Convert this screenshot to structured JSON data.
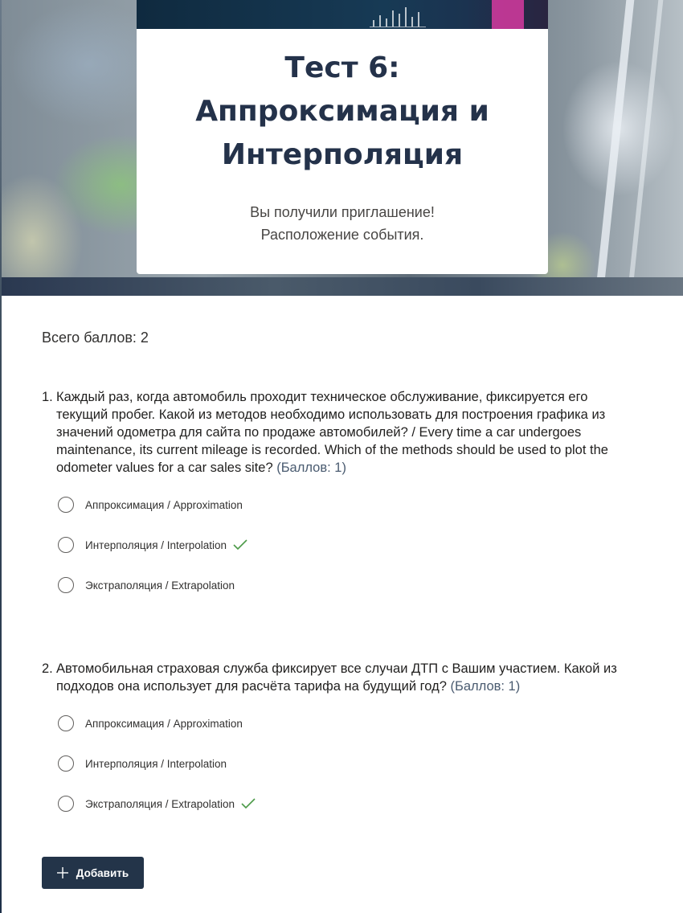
{
  "header": {
    "title_lines": [
      "Тест 6:",
      "Аппроксимация и",
      "Интерполяция"
    ],
    "subtitle_lines": [
      "Вы получили приглашение!",
      "Расположение события."
    ]
  },
  "total_points": "Всего баллов: 2",
  "questions": [
    {
      "number": "1.",
      "text": "Каждый раз, когда автомобиль проходит техническое обслуживание, фиксируется его текущий пробег. Какой из методов необходимо использовать для построения графика из значений одометра для сайта по продаже автомобилей? / Every time a car undergoes maintenance, its current mileage is recorded. Which of the methods should be used to plot the odometer values for a car sales site?",
      "points": "(Баллов: 1)",
      "options": [
        {
          "label": "Аппроксимация / Approximation",
          "correct": false
        },
        {
          "label": "Интерполяция / Interpolation",
          "correct": true
        },
        {
          "label": "Экстраполяция / Extrapolation",
          "correct": false
        }
      ]
    },
    {
      "number": "2.",
      "text": "Автомобильная страховая служба фиксирует все случаи ДТП с Вашим участием. Какой из подходов она использует для расчёта тарифа на будущий год?",
      "points": "(Баллов: 1)",
      "options": [
        {
          "label": "Аппроксимация / Approximation",
          "correct": false
        },
        {
          "label": "Интерполяция / Interpolation",
          "correct": false
        },
        {
          "label": "Экстраполяция / Extrapolation",
          "correct": true
        }
      ]
    }
  ],
  "add_button": {
    "label": "Добавить",
    "icon": "plus-icon"
  },
  "colors": {
    "accent": "#233449",
    "check": "#4c9a48",
    "title": "#24324a"
  }
}
